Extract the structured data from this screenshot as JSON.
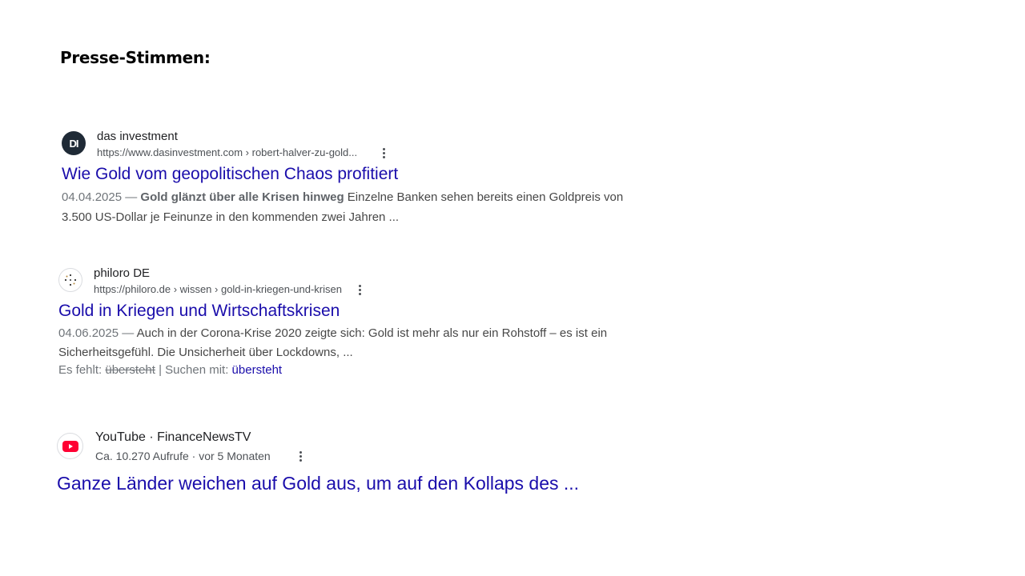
{
  "page": {
    "title": "Presse-Stimmen:"
  },
  "results": [
    {
      "favicon_text": "DI",
      "favicon_color": "#1f2a36",
      "site_name": "das investment",
      "url": "https://www.dasinvestment.com › robert-halver-zu-gold...",
      "title": "Wie Gold vom geopolitischen Chaos profitiert",
      "date": "04.04.2025",
      "separator": " — ",
      "snippet_bold": "Gold glänzt über alle Krisen hinweg",
      "snippet_text": " Einzelne Banken sehen bereits einen Goldpreis von 3.500 US-Dollar je Feinunze in den kommenden zwei Jahren ..."
    },
    {
      "favicon_icon": "philoro-dots-icon",
      "site_name": "philoro DE",
      "url": "https://philoro.de › wissen › gold-in-kriegen-und-krisen",
      "title": "Gold in Kriegen und Wirtschaftskrisen",
      "date": "04.06.2025",
      "separator": " — ",
      "snippet_text": "Auch in der Corona-Krise 2020 zeigte sich: Gold ist mehr als nur ein Rohstoff – es ist ein Sicherheitsgefühl. Die Unsicherheit über Lockdowns, ...",
      "missing_label": "Es fehlt:",
      "missing_word": "übersteht",
      "search_with_label": "| Suchen mit:",
      "search_with_word": "übersteht"
    },
    {
      "favicon_icon": "youtube-play-icon",
      "favicon_color": "#ff0033",
      "site_name": "YouTube · FinanceNewsTV",
      "meta": "Ca. 10.270 Aufrufe · vor 5 Monaten",
      "title": "Ganze Länder weichen auf Gold aus, um auf den Kollaps des ..."
    }
  ]
}
